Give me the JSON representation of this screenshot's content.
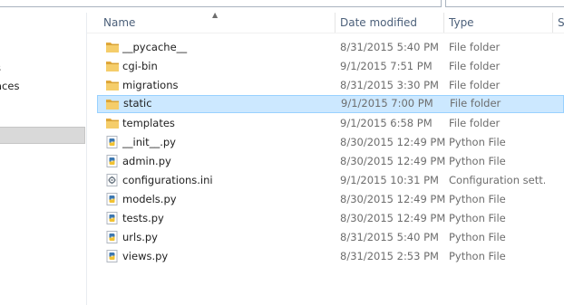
{
  "navigation": {
    "items": [
      {
        "label": "s"
      },
      {
        "label": "aces"
      }
    ]
  },
  "columns": {
    "name": "Name",
    "date_modified": "Date modified",
    "type": "Type",
    "size": "S"
  },
  "files": [
    {
      "name": "__pycache__",
      "date": "8/31/2015 5:40 PM",
      "type": "File folder",
      "icon": "folder-icon"
    },
    {
      "name": "cgi-bin",
      "date": "9/1/2015 7:51 PM",
      "type": "File folder",
      "icon": "folder-icon"
    },
    {
      "name": "migrations",
      "date": "8/31/2015 3:30 PM",
      "type": "File folder",
      "icon": "folder-icon"
    },
    {
      "name": "static",
      "date": "9/1/2015 7:00 PM",
      "type": "File folder",
      "icon": "folder-icon",
      "selected": true
    },
    {
      "name": "templates",
      "date": "9/1/2015 6:58 PM",
      "type": "File folder",
      "icon": "folder-icon"
    },
    {
      "name": "__init__.py",
      "date": "8/30/2015 12:49 PM",
      "type": "Python File",
      "icon": "python-file-icon"
    },
    {
      "name": "admin.py",
      "date": "8/30/2015 12:49 PM",
      "type": "Python File",
      "icon": "python-file-icon"
    },
    {
      "name": "configurations.ini",
      "date": "9/1/2015 10:31 PM",
      "type": "Configuration sett...",
      "icon": "config-file-icon"
    },
    {
      "name": "models.py",
      "date": "8/30/2015 12:49 PM",
      "type": "Python File",
      "icon": "python-file-icon"
    },
    {
      "name": "tests.py",
      "date": "8/30/2015 12:49 PM",
      "type": "Python File",
      "icon": "python-file-icon"
    },
    {
      "name": "urls.py",
      "date": "8/31/2015 5:40 PM",
      "type": "Python File",
      "icon": "python-file-icon"
    },
    {
      "name": "views.py",
      "date": "8/31/2015 2:53 PM",
      "type": "Python File",
      "icon": "python-file-icon"
    }
  ],
  "colors": {
    "selection_bg": "#cce8ff",
    "selection_border": "#99d1ff",
    "header_text": "#4c607a",
    "folder_yellow": "#e8b64a"
  }
}
